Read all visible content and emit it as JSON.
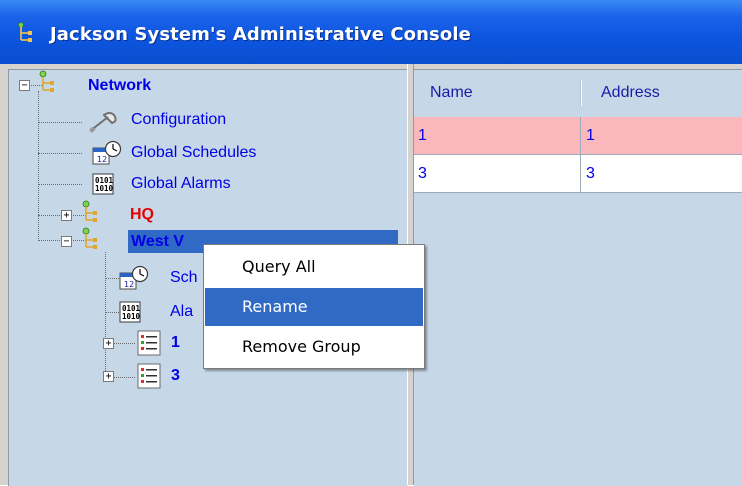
{
  "window": {
    "title": "Jackson System's Administrative Console"
  },
  "tree": {
    "items": [
      {
        "label": "Network",
        "icon": "network-node-icon",
        "expander": "−"
      },
      {
        "label": "Configuration",
        "icon": "wrench-icon"
      },
      {
        "label": "Global Schedules",
        "icon": "schedule-clock-icon"
      },
      {
        "label": "Global Alarms",
        "icon": "alarm-binary-icon"
      },
      {
        "label": "HQ",
        "icon": "network-node-icon",
        "expander": "+"
      },
      {
        "label": "West V",
        "icon": "network-node-icon",
        "expander": "−"
      },
      {
        "label": "Sch",
        "icon": "schedule-clock-icon"
      },
      {
        "label": "Ala",
        "icon": "alarm-binary-icon"
      },
      {
        "label": "1",
        "icon": "device-list-icon",
        "expander": "+"
      },
      {
        "label": "3",
        "icon": "device-list-icon",
        "expander": "+"
      }
    ]
  },
  "table": {
    "columns": [
      "Name",
      "Address"
    ],
    "rows": [
      {
        "name": "1",
        "address": "1",
        "highlight": "#fbb8bc"
      },
      {
        "name": "3",
        "address": "3",
        "highlight": "#ffffff"
      }
    ]
  },
  "context_menu": {
    "items": [
      {
        "label": "Query All"
      },
      {
        "label": "Rename",
        "active": true
      },
      {
        "label": "Remove Group"
      }
    ]
  },
  "colors": {
    "titlebar": "#0d55df",
    "selection": "#316ac5",
    "pane_background": "#c6d8e8",
    "link_blue": "#0000e6",
    "alert_red": "#e60000"
  }
}
